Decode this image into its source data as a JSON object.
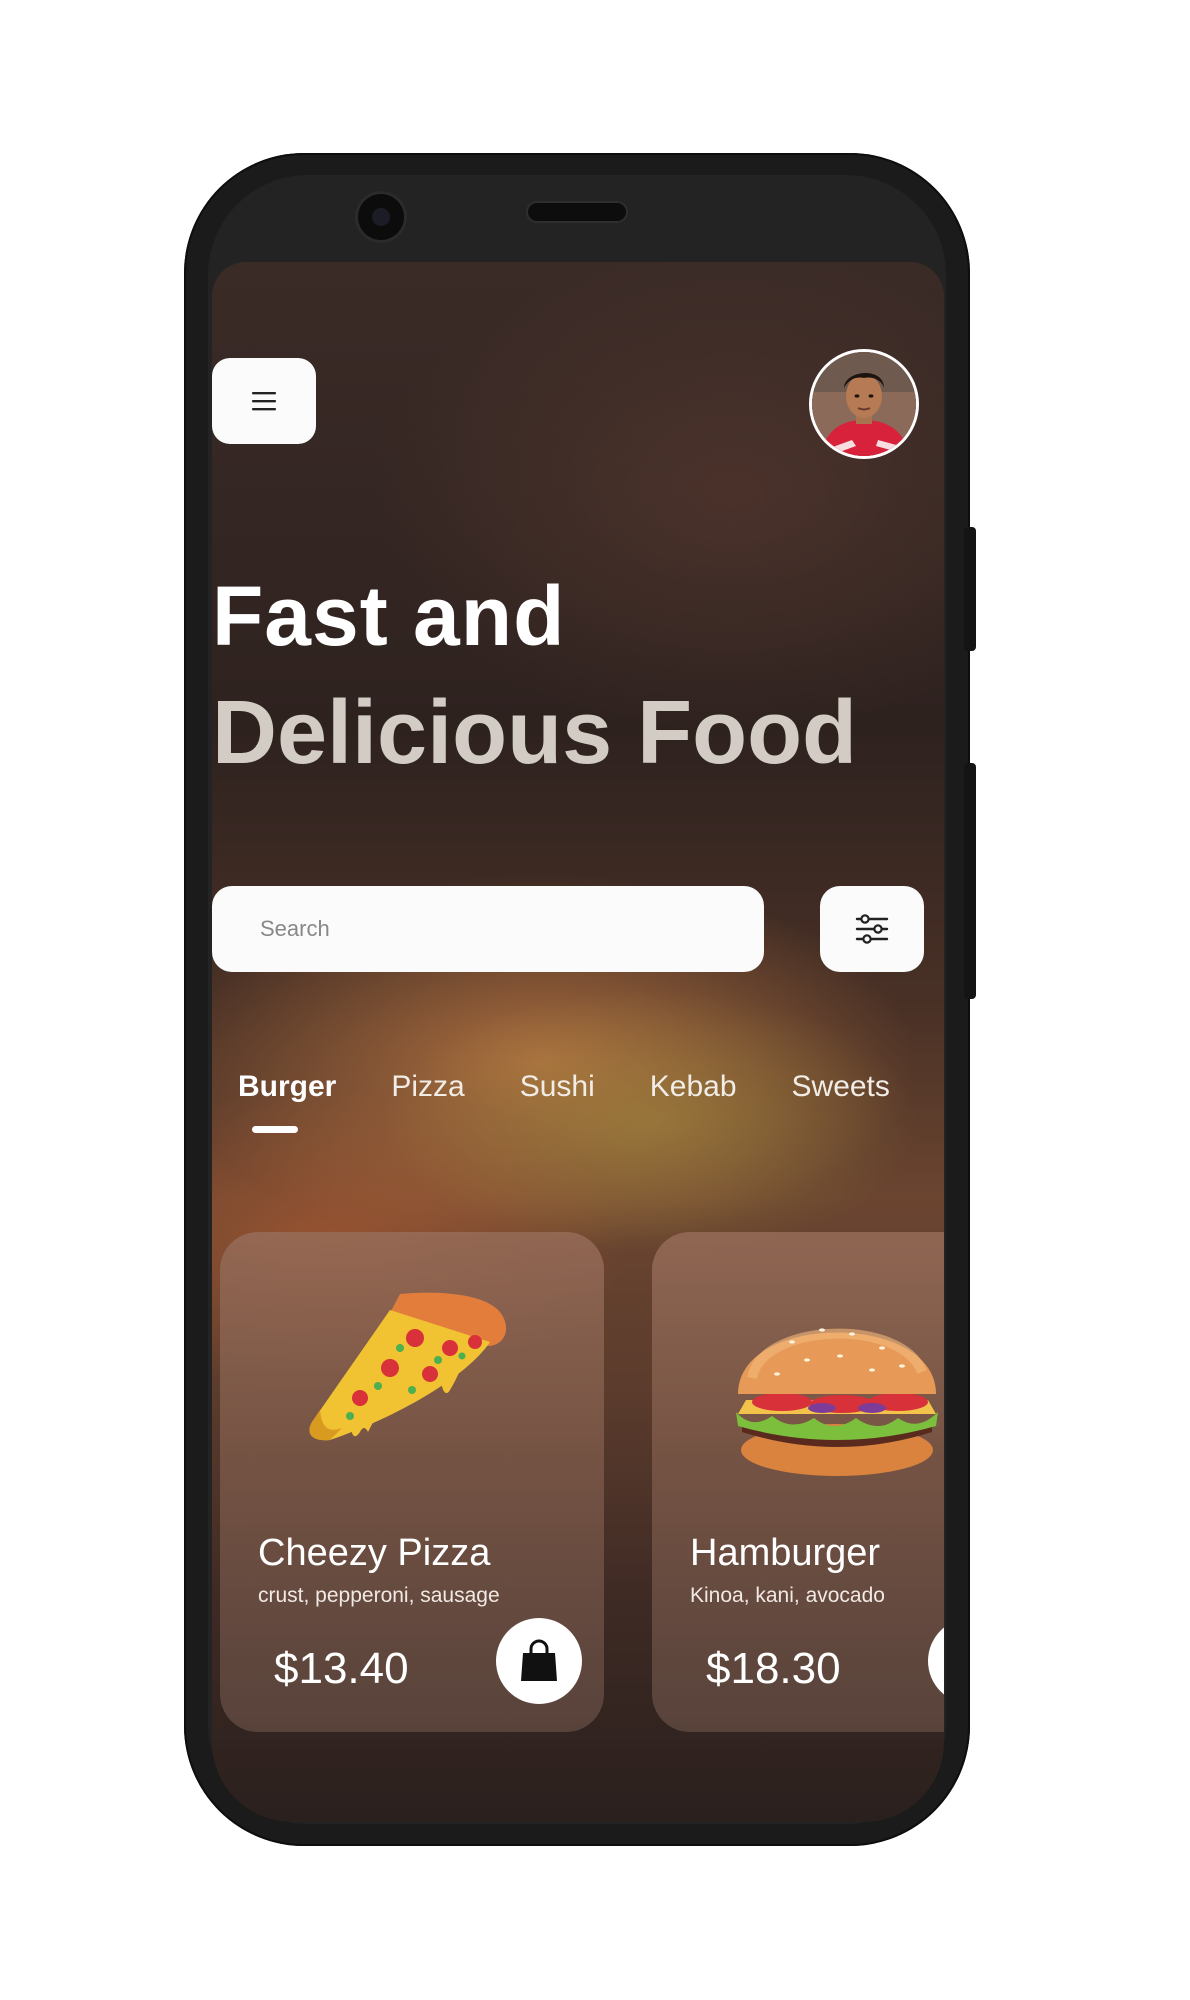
{
  "header": {
    "menu_icon": "hamburger-menu-icon",
    "avatar_icon": "user-avatar"
  },
  "hero": {
    "line1": "Fast and",
    "line2": "Delicious Food"
  },
  "search": {
    "placeholder": "Search",
    "value": "",
    "filter_icon": "sliders-filter-icon"
  },
  "categories": {
    "items": [
      "Burger",
      "Pizza",
      "Sushi",
      "Kebab",
      "Sweets"
    ],
    "selected": "Burger"
  },
  "products": [
    {
      "name": "Cheezy Pizza",
      "description": "crust, pepperoni, sausage",
      "price": "$13.40",
      "image_icon": "pizza-slice-icon",
      "cart_icon": "shopping-bag-icon"
    },
    {
      "name": "Hamburger",
      "description": "Kinoa, kani, avocado",
      "price": "$18.30",
      "image_icon": "hamburger-food-icon",
      "cart_icon": "shopping-bag-icon"
    }
  ],
  "colors": {
    "accent": "#ffffff",
    "headline_secondary": "#d2ccc4",
    "phone_frame": "#1b1b1b"
  }
}
